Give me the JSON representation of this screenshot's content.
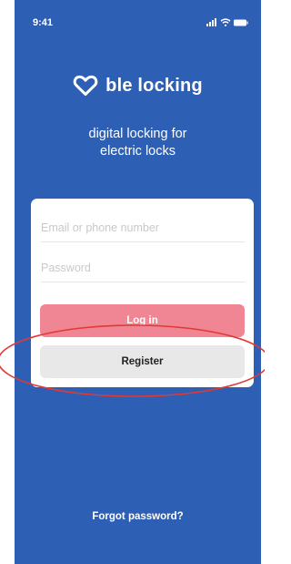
{
  "status_bar": {
    "time": "9:41",
    "icons": [
      "signal-icon",
      "wifi-icon",
      "battery-icon"
    ]
  },
  "brand": {
    "name": "ble locking",
    "icon": "heart-outline-icon"
  },
  "tagline": {
    "line1": "digital locking for",
    "line2": "electric locks"
  },
  "login_form": {
    "email_placeholder": "Email or phone number",
    "password_placeholder": "Password",
    "login_label": "Log in",
    "register_label": "Register"
  },
  "forgot_password_label": "Forgot password?",
  "colors": {
    "background": "#2d5fb4",
    "login_button": "#f08593",
    "register_button": "#e8e8e8",
    "annotation": "#e03a35"
  }
}
